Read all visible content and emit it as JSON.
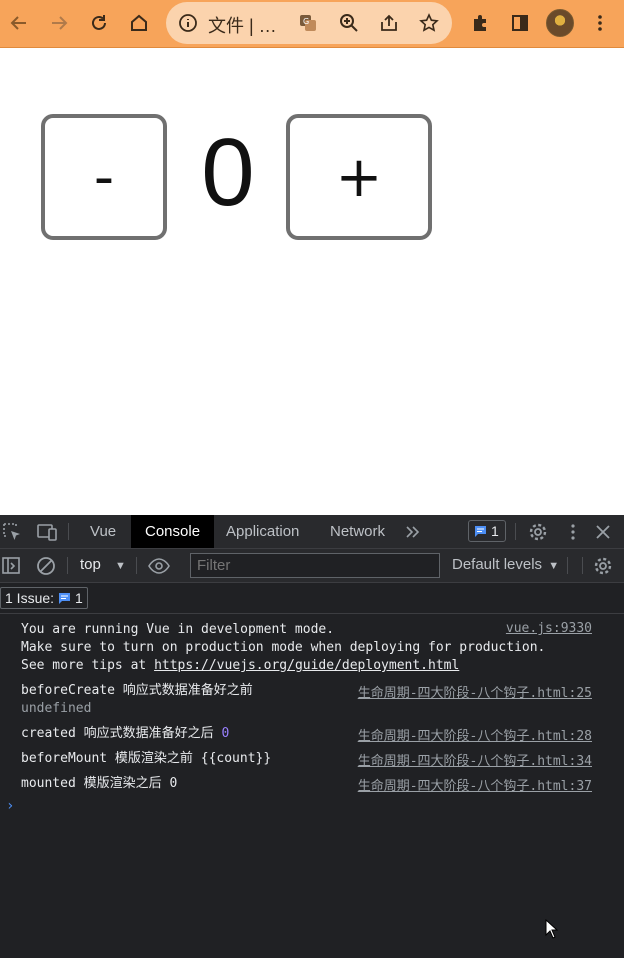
{
  "browser": {
    "address_text": "文件 | …"
  },
  "page": {
    "decrement_label": "-",
    "count": "0",
    "increment_label": "+"
  },
  "devtools": {
    "tabs": [
      "Vue",
      "Console",
      "Application",
      "Network"
    ],
    "active_tab": "Console",
    "issue_badge_count": "1",
    "context": "top",
    "filter_placeholder": "Filter",
    "levels_label": "Default levels",
    "issues_label": "1 Issue:",
    "issues_count": "1",
    "messages": [
      {
        "lines": [
          "You are running Vue in development mode.",
          "Make sure to turn on production mode when deploying for production.",
          "See more tips at "
        ],
        "link": "https://vuejs.org/guide/deployment.html",
        "source": "vue.js:9330"
      },
      {
        "text": "beforeCreate 响应式数据准备好之前",
        "extra": "undefined",
        "source": "生命周期-四大阶段-八个钩子.html:25"
      },
      {
        "text": "created 响应式数据准备好之后 ",
        "value": "0",
        "source": "生命周期-四大阶段-八个钩子.html:28"
      },
      {
        "text": "beforeMount 模版渲染之前 {{count}}",
        "source": "生命周期-四大阶段-八个钩子.html:34"
      },
      {
        "text": "mounted 模版渲染之后 0",
        "source": "生命周期-四大阶段-八个钩子.html:37"
      }
    ],
    "prompt_symbol": "›"
  },
  "colors": {
    "toolbar": "#f7a45a",
    "devtools_bg": "#202124",
    "number_purple": "#9980ff"
  }
}
